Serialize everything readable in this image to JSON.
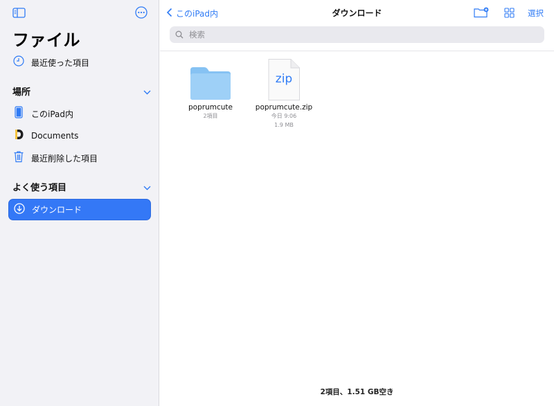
{
  "sidebar": {
    "title": "ファイル",
    "recents_label": "最近使った項目",
    "locations": {
      "header": "場所",
      "items": [
        {
          "label": "このiPad内"
        },
        {
          "label": "Documents"
        },
        {
          "label": "最近削除した項目"
        }
      ]
    },
    "favorites": {
      "header": "よく使う項目",
      "items": [
        {
          "label": "ダウンロード",
          "selected": true
        }
      ]
    }
  },
  "main": {
    "back_label": "このiPad内",
    "title": "ダウンロード",
    "select_label": "選択",
    "search": {
      "placeholder": "検索"
    },
    "files": [
      {
        "name": "poprumcute",
        "type": "folder",
        "meta1": "2項目",
        "meta2": ""
      },
      {
        "name": "poprumcute.zip",
        "type": "zip",
        "icon_text": "zip",
        "meta1": "今日 9:06",
        "meta2": "1.9 MB"
      }
    ],
    "footer": "2項目、1.51 GB空き"
  },
  "colors": {
    "accent": "#3478f6",
    "sidebar_bg": "#f2f2f6",
    "folder": "#86c2f3"
  }
}
